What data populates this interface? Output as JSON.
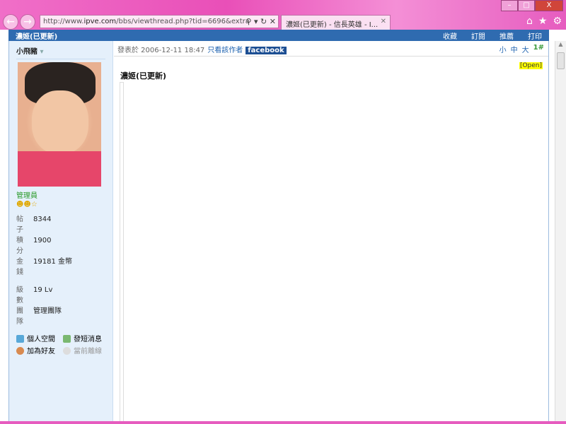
{
  "browser": {
    "url_prefix": "http://www.",
    "url_domain": "ipve.com",
    "url_rest": "/bbs/viewthread.php?tid=6696&extra",
    "tab_title": "濃姬(已更新) - 信長英雄 - I...",
    "window_buttons": [
      "–",
      "□",
      "X"
    ]
  },
  "header": {
    "title": "濃姬(已更新)",
    "links": [
      "收藏",
      "訂閱",
      "推薦",
      "打印"
    ]
  },
  "user": {
    "name": "小飛豬",
    "role": "管理員",
    "stats": [
      {
        "k": "帖子",
        "v": "8344"
      },
      {
        "k": "積分",
        "v": "1900"
      },
      {
        "k": "金錢",
        "v": "19181 金幣"
      }
    ],
    "stats2": [
      {
        "k": "級數",
        "v": "19 Lv"
      },
      {
        "k": "團隊",
        "v": "管理團隊"
      }
    ],
    "actions": [
      "個人空間",
      "發短消息",
      "加為好友",
      "當前離線"
    ]
  },
  "post": {
    "posted": "發表於 2006-12-11 18:47",
    "author_only": "只看該作者",
    "facebook": "facebook",
    "sizes": [
      "小",
      "中",
      "大"
    ],
    "floor": "1#",
    "open": "[Open]",
    "title": "濃姬(已更新)"
  }
}
